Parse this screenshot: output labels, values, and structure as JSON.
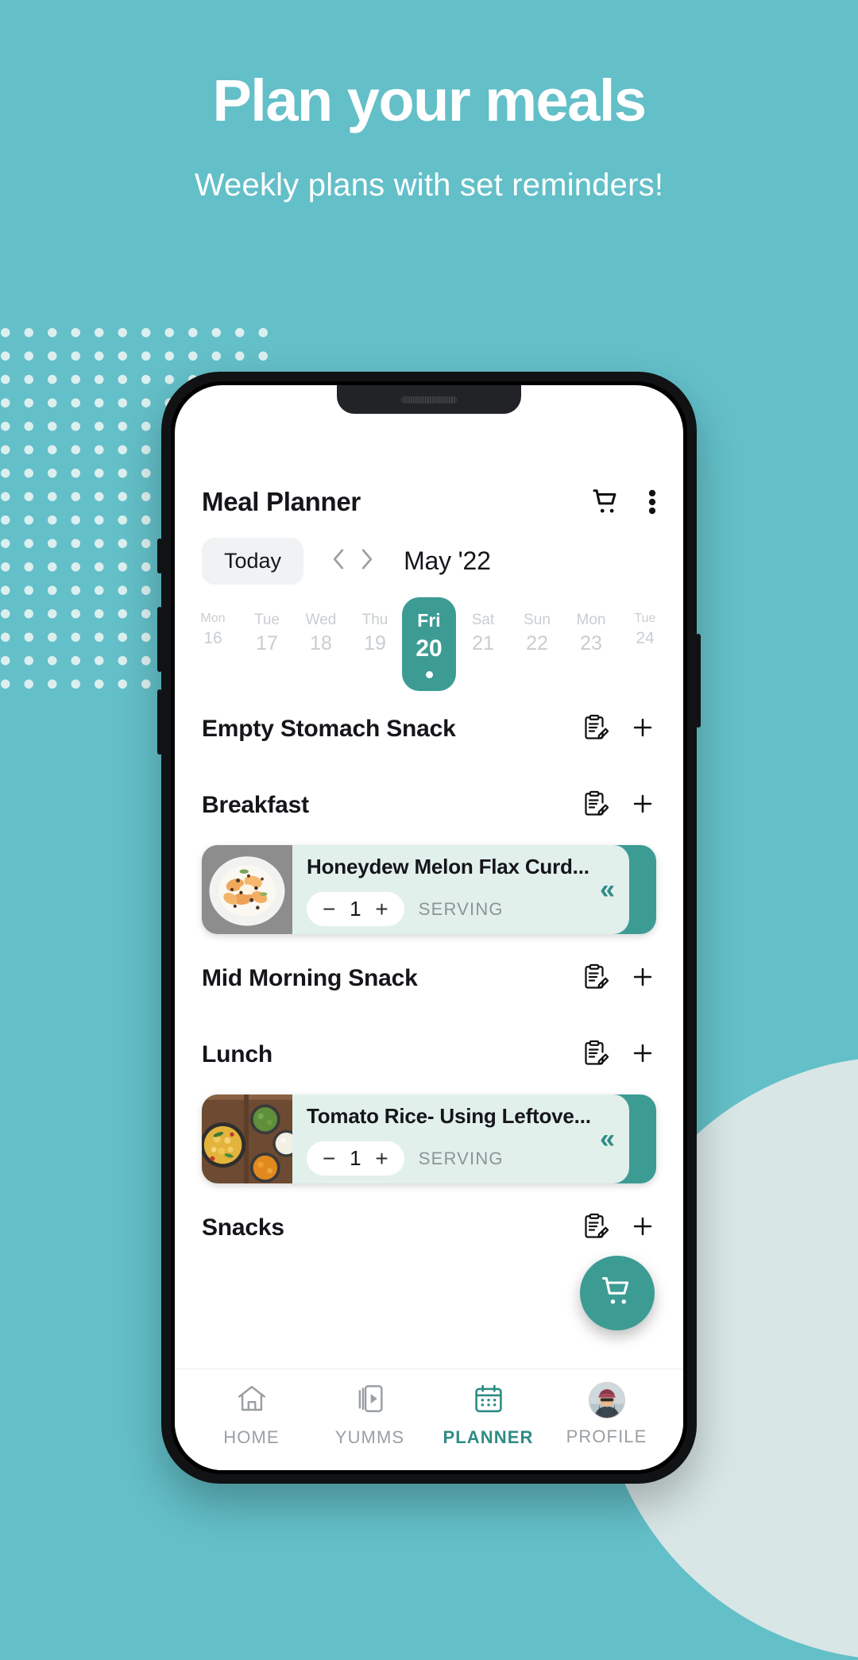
{
  "promo": {
    "headline": "Plan your meals",
    "subheadline": "Weekly plans with set reminders!",
    "background_color": "#63BFC8",
    "dot_color": "#DCEFEF",
    "circle_color": "#D8E6E6"
  },
  "app": {
    "accent_color": "#3C9C94",
    "header": {
      "title": "Meal Planner",
      "cart_icon": "shopping-cart-icon",
      "menu_icon": "more-vertical-icon"
    },
    "month_bar": {
      "today_label": "Today",
      "prev_icon": "chevron-left-icon",
      "next_icon": "chevron-right-icon",
      "month_label": "May '22"
    },
    "date_strip": [
      {
        "dow": "Mon",
        "date": "16",
        "selected": false,
        "edge": true
      },
      {
        "dow": "Tue",
        "date": "17",
        "selected": false,
        "edge": false
      },
      {
        "dow": "Wed",
        "date": "18",
        "selected": false,
        "edge": false
      },
      {
        "dow": "Thu",
        "date": "19",
        "selected": false,
        "edge": false
      },
      {
        "dow": "Fri",
        "date": "20",
        "selected": true,
        "edge": false
      },
      {
        "dow": "Sat",
        "date": "21",
        "selected": false,
        "edge": false
      },
      {
        "dow": "Sun",
        "date": "22",
        "selected": false,
        "edge": false
      },
      {
        "dow": "Mon",
        "date": "23",
        "selected": false,
        "edge": false
      },
      {
        "dow": "Tue",
        "date": "24",
        "selected": false,
        "edge": true
      }
    ],
    "meals": [
      {
        "name": "Empty Stomach Snack",
        "note_icon": "clipboard-pencil-icon",
        "add_icon": "plus-icon"
      },
      {
        "name": "Breakfast",
        "note_icon": "clipboard-pencil-icon",
        "add_icon": "plus-icon"
      },
      {
        "name": "Mid Morning Snack",
        "note_icon": "clipboard-pencil-icon",
        "add_icon": "plus-icon"
      },
      {
        "name": "Lunch",
        "note_icon": "clipboard-pencil-icon",
        "add_icon": "plus-icon"
      },
      {
        "name": "Snacks",
        "note_icon": "clipboard-pencil-icon",
        "add_icon": "plus-icon"
      }
    ],
    "cards": {
      "breakfast": {
        "recipe_name": "Honeydew Melon Flax Curd...",
        "minus_label": "−",
        "serving_count": "1",
        "plus_label": "+",
        "serving_label": "SERVING",
        "collapse_icon": "chevron-double-left-icon",
        "collapse_label": "«"
      },
      "lunch": {
        "recipe_name": "Tomato Rice- Using Leftove...",
        "minus_label": "−",
        "serving_count": "1",
        "plus_label": "+",
        "serving_label": "SERVING",
        "collapse_icon": "chevron-double-left-icon",
        "collapse_label": "«"
      }
    },
    "fab": {
      "icon": "shopping-cart-icon"
    },
    "bottom_nav": [
      {
        "label": "HOME",
        "icon": "home-icon",
        "active": false
      },
      {
        "label": "YUMMS",
        "icon": "video-icon",
        "active": false
      },
      {
        "label": "PLANNER",
        "icon": "calendar-icon",
        "active": true
      },
      {
        "label": "PROFILE",
        "icon": "avatar-icon",
        "active": false
      }
    ]
  }
}
